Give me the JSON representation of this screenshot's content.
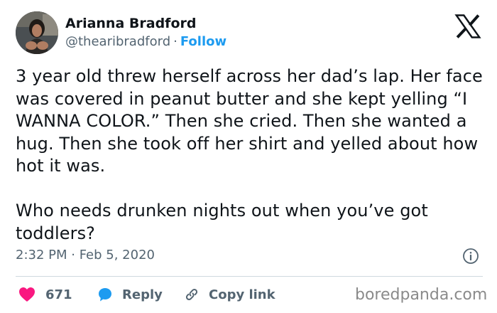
{
  "author": {
    "name": "Arianna Bradford",
    "handle": "@thearibradford",
    "separator": "·",
    "follow_label": "Follow",
    "avatar_icon": "profile-photo"
  },
  "platform": {
    "logo_icon": "x-logo"
  },
  "tweet": {
    "paragraph_1": "3 year old threw herself across her dad’s lap. Her face was covered in peanut butter and she kept yelling “I WANNA COLOR.” Then she cried. Then she wanted a hug. Then she took off her shirt and yelled about how hot it was.",
    "paragraph_2": "Who needs drunken nights out when you’ve got toddlers?"
  },
  "meta": {
    "timestamp": "2:32 PM · Feb 5, 2020",
    "info_icon": "info-icon"
  },
  "actions": {
    "like_count": "671",
    "reply_label": "Reply",
    "copy_link_label": "Copy link"
  },
  "colors": {
    "accent": "#1d9bf0",
    "like": "#f91880",
    "text": "#0f1419",
    "secondary": "#536471"
  },
  "watermark": {
    "text": "boredpanda.com"
  }
}
